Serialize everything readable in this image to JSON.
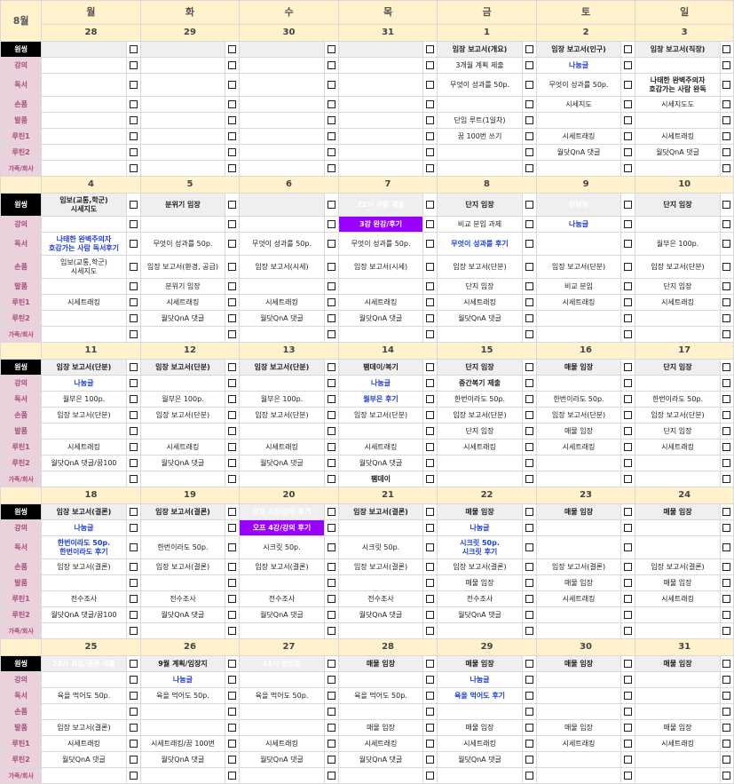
{
  "month": "8월",
  "days": [
    "월",
    "화",
    "수",
    "목",
    "금",
    "토",
    "일"
  ],
  "row_labels": [
    "원씽",
    "강의",
    "독서",
    "손품",
    "발품",
    "루틴1",
    "루틴2",
    "가족/회사"
  ],
  "weeks": [
    {
      "dates": [
        "28",
        "29",
        "30",
        "31",
        "1",
        "2",
        "3"
      ],
      "rows": [
        [
          "",
          "",
          "",
          "",
          "임장 보고서(개요)",
          "임장 보고서(인구)",
          "임장 보고서(직장)"
        ],
        [
          "",
          "",
          "",
          "",
          "3개월 계획 제출",
          "나눔글",
          ""
        ],
        [
          "",
          "",
          "",
          "",
          "무엇이 성과를 50p.",
          "무엇이 성과를 50p.",
          "나태한 완벽주의자\n호감가는 사람 완독"
        ],
        [
          "",
          "",
          "",
          "",
          "",
          "시세지도",
          "시세지도도"
        ],
        [
          "",
          "",
          "",
          "",
          "단임 루트(1일차)",
          "",
          ""
        ],
        [
          "",
          "",
          "",
          "",
          "꿈 100번 쓰기",
          "시세트래킹",
          "시세트래킹"
        ],
        [
          "",
          "",
          "",
          "",
          "",
          "월닷QnA 댓글",
          "월닷QnA 댓글"
        ],
        [
          "",
          "",
          "",
          "",
          "",
          "",
          ""
        ]
      ]
    },
    {
      "dates": [
        "4",
        "5",
        "6",
        "7",
        "8",
        "9",
        "10"
      ],
      "rows": [
        [
          "임보(교통,학군)\n시세지도",
          "분위기 임장",
          "",
          "22시 사임 제출",
          "단지 임장",
          "반임장",
          "단지 임장"
        ],
        [
          "",
          "",
          "",
          "3강 완강/후기",
          "비교 분임 과제",
          "나눔글",
          ""
        ],
        [
          "나태한 완벽주의자\n호감가는 사람 독서후기",
          "무엇이 성과를 50p.",
          "무엇이 성과를 50p.",
          "무엇이 성과를 50p.",
          "무엇이 성과를 후기",
          "",
          "월부은 100p."
        ],
        [
          "임보(교통,학군)\n시세지도",
          "임장 보고서(환경, 공급)",
          "임장 보고서(시세)",
          "임장 보고서(시세)",
          "임장 보고서(단분)",
          "임장 보고서(단분)",
          "임장 보고서(단분)"
        ],
        [
          "",
          "분위기 임장",
          "",
          "",
          "단지 임장",
          "비교 분임",
          "단지 임장"
        ],
        [
          "시세트래킹",
          "시세트래킹",
          "시세트래킹",
          "시세트래킹",
          "시세트래킹",
          "시세트래킹",
          "시세트래킹"
        ],
        [
          "",
          "월닷QnA 댓글",
          "월닷QnA 댓글",
          "월닷QnA 댓글",
          "월닷QnA 댓글",
          "",
          ""
        ],
        [
          "",
          "",
          "",
          "",
          "",
          "",
          ""
        ]
      ]
    },
    {
      "dates": [
        "11",
        "12",
        "13",
        "14",
        "15",
        "16",
        "17"
      ],
      "rows": [
        [
          "임장 보고서(단분)",
          "임장 보고서(단분)",
          "임장 보고서(단분)",
          "팸데이/복기",
          "단지 임장",
          "매물 임장",
          "단지 임장"
        ],
        [
          "나눔글",
          "",
          "",
          "나눔글",
          "중간복기 제출",
          "",
          ""
        ],
        [
          "월부은 100p.",
          "월부은 100p.",
          "월부은 100p.",
          "월부은 후기",
          "한번이라도 50p.",
          "한번이라도 50p.",
          "한번이라도 50p."
        ],
        [
          "임장 보고서(단분)",
          "임장 보고서(단분)",
          "임장 보고서(단분)",
          "임장 보고서(단분)",
          "임장 보고서(단분)",
          "임장 보고서(단분)",
          "임장 보고서(단분)"
        ],
        [
          "",
          "",
          "",
          "",
          "단지 임장",
          "매물 임장",
          "단지 임장"
        ],
        [
          "시세트래킹",
          "시세트래킹",
          "시세트래킹",
          "시세트래킹",
          "시세트래킹",
          "시세트래킹",
          "시세트래킹"
        ],
        [
          "월닷QnA 댓글/꿈100",
          "월닷QnA 댓글",
          "월닷QnA 댓글",
          "월닷QnA 댓글",
          "",
          "",
          ""
        ],
        [
          "",
          "",
          "",
          "팸데이",
          "",
          "",
          ""
        ]
      ]
    },
    {
      "dates": [
        "18",
        "19",
        "20",
        "21",
        "22",
        "23",
        "24"
      ],
      "rows": [
        [
          "임장 보고서(결론)",
          "임장 보고서(결론)",
          "오프 4강/강의 후기",
          "임장 보고서(결론)",
          "매물 임장",
          "매물 임장",
          "매물 임장"
        ],
        [
          "나눔글",
          "",
          "오프 4강/강의 후기",
          "",
          "나눔글",
          "",
          ""
        ],
        [
          "한번이라도 50p.\n한번이라도 후기",
          "한번이라도 50p.",
          "시크릿 50p.",
          "시크릿 50p.",
          "시크릿 50p.\n시크릿 후기",
          "",
          ""
        ],
        [
          "임장 보고서(결론)",
          "임장 보고서(결론)",
          "임장 보고서(결론)",
          "임장 보고서(결론)",
          "임장 보고서(결론)",
          "임장 보고서(결론)",
          "임장 보고서(결론)"
        ],
        [
          "",
          "",
          "",
          "",
          "매물 임장",
          "매물 임장",
          "매물 임장"
        ],
        [
          "전수조사",
          "전수조사",
          "전수조사",
          "전수조사",
          "전수조사",
          "시세트래킹",
          "시세트래킹"
        ],
        [
          "월닷QnA 댓글/꿈100",
          "월닷QnA 댓글",
          "월닷QnA 댓글",
          "월닷QnA 댓글",
          "월닷QnA 댓글",
          "",
          ""
        ],
        [
          "",
          "",
          "",
          "",
          "",
          "",
          ""
        ]
      ]
    },
    {
      "dates": [
        "25",
        "26",
        "27",
        "28",
        "29",
        "30",
        "31"
      ],
      "rows": [
        [
          "22시 최임/결론 제출",
          "9월 계획/임장지",
          "19시 반모임",
          "매물 임장",
          "매물 임장",
          "매물 임장",
          "매물 임장"
        ],
        [
          "",
          "나눔글",
          "",
          "",
          "나눔글",
          "",
          ""
        ],
        [
          "육을 먹어도 50p.",
          "육을 먹어도 50p.",
          "육을 먹어도 50p.",
          "육을 먹어도 50p.",
          "육을 먹어도 후기",
          "",
          ""
        ],
        [
          "",
          "",
          "",
          "",
          "",
          "",
          ""
        ],
        [
          "임장 보고서(결론)",
          "",
          "",
          "매물 임장",
          "매물 임장",
          "매물 임장",
          "매물 임장"
        ],
        [
          "시세트래킹",
          "시세트래킹/꿈 100번",
          "시세트래킹",
          "시세트래킹",
          "시세트래킹",
          "시세트래킹",
          "시세트래킹"
        ],
        [
          "월닷QnA 댓글",
          "월닷QnA 댓글",
          "월닷QnA 댓글",
          "월닷QnA 댓글",
          "월닷QnA 댓글",
          "",
          ""
        ],
        [
          "",
          "",
          "",
          "",
          "",
          "",
          ""
        ]
      ]
    }
  ],
  "colors": {
    "header_bg": "#fff2cc",
    "saturday": "#1f3fd6",
    "sunday": "#e03030",
    "highlight_red": "#ff0000",
    "highlight_purple": "#9900ff",
    "label_pink": "#ead1dc"
  },
  "icons": {
    "checkbox": "checkbox-icon"
  }
}
